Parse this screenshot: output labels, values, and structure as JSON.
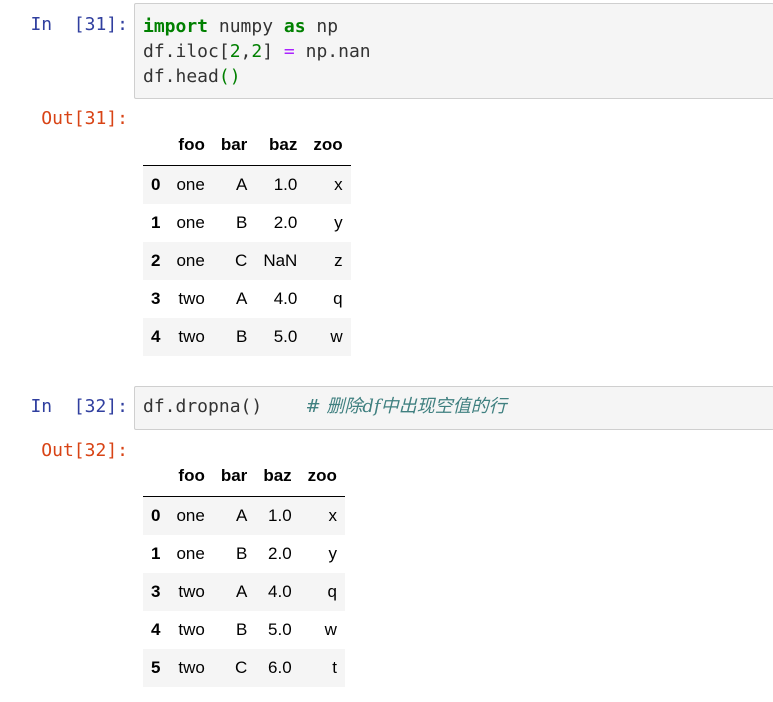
{
  "cell1": {
    "in_prompt": "In  [31]:",
    "code": {
      "l1": {
        "kw1": "import",
        "t1": " numpy ",
        "kw2": "as",
        "t2": " np"
      },
      "l2": {
        "t1": "df.iloc[",
        "n1": "2",
        "t2": ",",
        "n2": "2",
        "t3": "] ",
        "op": "=",
        "t4": " np.nan"
      },
      "l3": {
        "t1": "df.head",
        "p": "()"
      }
    },
    "out_prompt": "Out[31]:",
    "table": {
      "columns": [
        "foo",
        "bar",
        "baz",
        "zoo"
      ],
      "rows": [
        {
          "idx": "0",
          "foo": "one",
          "bar": "A",
          "baz": "1.0",
          "zoo": "x"
        },
        {
          "idx": "1",
          "foo": "one",
          "bar": "B",
          "baz": "2.0",
          "zoo": "y"
        },
        {
          "idx": "2",
          "foo": "one",
          "bar": "C",
          "baz": "NaN",
          "zoo": "z"
        },
        {
          "idx": "3",
          "foo": "two",
          "bar": "A",
          "baz": "4.0",
          "zoo": "q"
        },
        {
          "idx": "4",
          "foo": "two",
          "bar": "B",
          "baz": "5.0",
          "zoo": "w"
        }
      ]
    }
  },
  "cell2": {
    "in_prompt": "In  [32]:",
    "code": {
      "l1": {
        "t1": "df.dropna()",
        "cmt": "# 删除df中出现空值的行"
      }
    },
    "out_prompt": "Out[32]:",
    "table": {
      "columns": [
        "foo",
        "bar",
        "baz",
        "zoo"
      ],
      "rows": [
        {
          "idx": "0",
          "foo": "one",
          "bar": "A",
          "baz": "1.0",
          "zoo": "x"
        },
        {
          "idx": "1",
          "foo": "one",
          "bar": "B",
          "baz": "2.0",
          "zoo": "y"
        },
        {
          "idx": "3",
          "foo": "two",
          "bar": "A",
          "baz": "4.0",
          "zoo": "q"
        },
        {
          "idx": "4",
          "foo": "two",
          "bar": "B",
          "baz": "5.0",
          "zoo": "w"
        },
        {
          "idx": "5",
          "foo": "two",
          "bar": "C",
          "baz": "6.0",
          "zoo": "t"
        }
      ]
    }
  }
}
